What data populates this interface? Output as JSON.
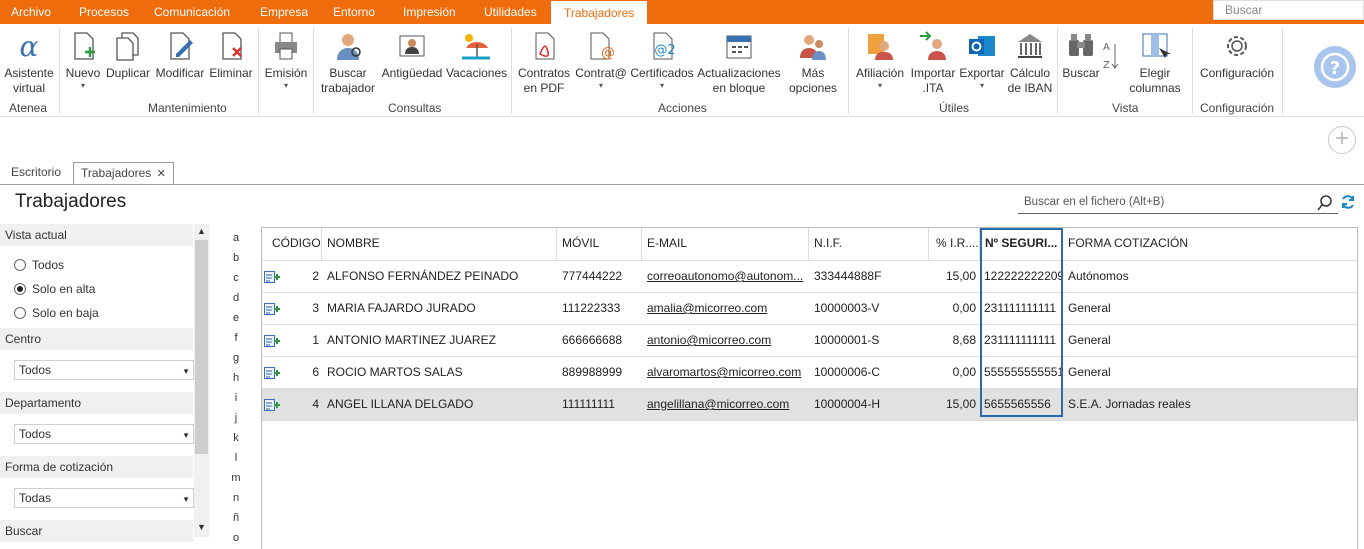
{
  "menu": {
    "tabs": [
      "Archivo",
      "Procesos",
      "Comunicación",
      "Empresa",
      "Entorno",
      "Impresión",
      "Utilidades",
      "Trabajadores"
    ],
    "active": "Trabajadores",
    "search_placeholder": "Buscar"
  },
  "ribbon": {
    "buttons": {
      "asistente": "Asistente virtual",
      "nuevo": "Nuevo",
      "duplicar": "Duplicar",
      "modificar": "Modificar",
      "eliminar": "Eliminar",
      "emision": "Emisión",
      "buscar_trab": "Buscar trabajador",
      "antiguedad": "Antigüedad",
      "vacaciones": "Vacaciones",
      "contratos": "Contratos en PDF",
      "contrata": "Contrat@",
      "certificados": "Certificados",
      "actualizaciones": "Actualizaciones en bloque",
      "mas": "Más opciones",
      "afiliacion": "Afiliación",
      "importar": "Importar .ITA",
      "exportar": "Exportar",
      "calculo": "Cálculo de IBAN",
      "buscar": "Buscar",
      "elegir": "Elegir columnas",
      "configuracion": "Configuración"
    },
    "groups": {
      "atenea": "Atenea",
      "mantenimiento": "Mantenimiento",
      "consultas": "Consultas",
      "acciones": "Acciones",
      "utiles": "Útiles",
      "vista": "Vista",
      "configuracion": "Configuración"
    }
  },
  "doc_tabs": {
    "escritorio": "Escritorio",
    "trabajadores": "Trabajadores",
    "close": "✕"
  },
  "page": {
    "title": "Trabajadores",
    "search_placeholder": "Buscar en el fichero (Alt+B)"
  },
  "sidebar": {
    "vista_actual": "Vista actual",
    "radios": [
      "Todos",
      "Solo en alta",
      "Solo en baja"
    ],
    "radio_selected": "Solo en alta",
    "centro": "Centro",
    "centro_value": "Todos",
    "departamento": "Departamento",
    "departamento_value": "Todos",
    "forma": "Forma de cotización",
    "forma_value": "Todas",
    "buscar": "Buscar"
  },
  "alphabet": [
    "a",
    "b",
    "c",
    "d",
    "e",
    "f",
    "g",
    "h",
    "i",
    "j",
    "k",
    "l",
    "m",
    "n",
    "ñ",
    "o"
  ],
  "table": {
    "headers": [
      "CÓDIGO",
      "NOMBRE",
      "MÓVIL",
      "E-MAIL",
      "N.I.F.",
      "% I.R....",
      "Nº SEGURI...",
      "FORMA COTIZACIÓN"
    ],
    "rows": [
      {
        "codigo": "2",
        "nombre": "ALFONSO FERNÁNDEZ PEINADO",
        "movil": "777444222",
        "email": "correoautonomo@autonom...",
        "nif": "333444888F",
        "irpf": "15,00",
        "nss": "122222222209",
        "forma": "Autónomos"
      },
      {
        "codigo": "3",
        "nombre": "MARIA FAJARDO JURADO",
        "movil": "111222333",
        "email": "amalia@micorreo.com",
        "nif": "10000003-V",
        "irpf": "0,00",
        "nss": "231111111111",
        "forma": "General"
      },
      {
        "codigo": "1",
        "nombre": "ANTONIO MARTINEZ JUAREZ",
        "movil": "666666688",
        "email": "antonio@micorreo.com",
        "nif": "10000001-S",
        "irpf": "8,68",
        "nss": "231111111111",
        "forma": "General"
      },
      {
        "codigo": "6",
        "nombre": "ROCIO MARTOS SALAS",
        "movil": "889988999",
        "email": "alvaromartos@micorreo.com",
        "nif": "10000006-C",
        "irpf": "0,00",
        "nss": "555555555551",
        "forma": "General"
      },
      {
        "codigo": "4",
        "nombre": "ANGEL ILLANA DELGADO",
        "movil": "111111111",
        "email": "angelillana@micorreo.com",
        "nif": "10000004-H",
        "irpf": "15,00",
        "nss": "5655565556",
        "forma": "S.E.A. Jornadas reales"
      }
    ],
    "selected_row": 4
  },
  "colors": {
    "accent": "#ee6c0c",
    "selection": "#2b6ca8"
  }
}
